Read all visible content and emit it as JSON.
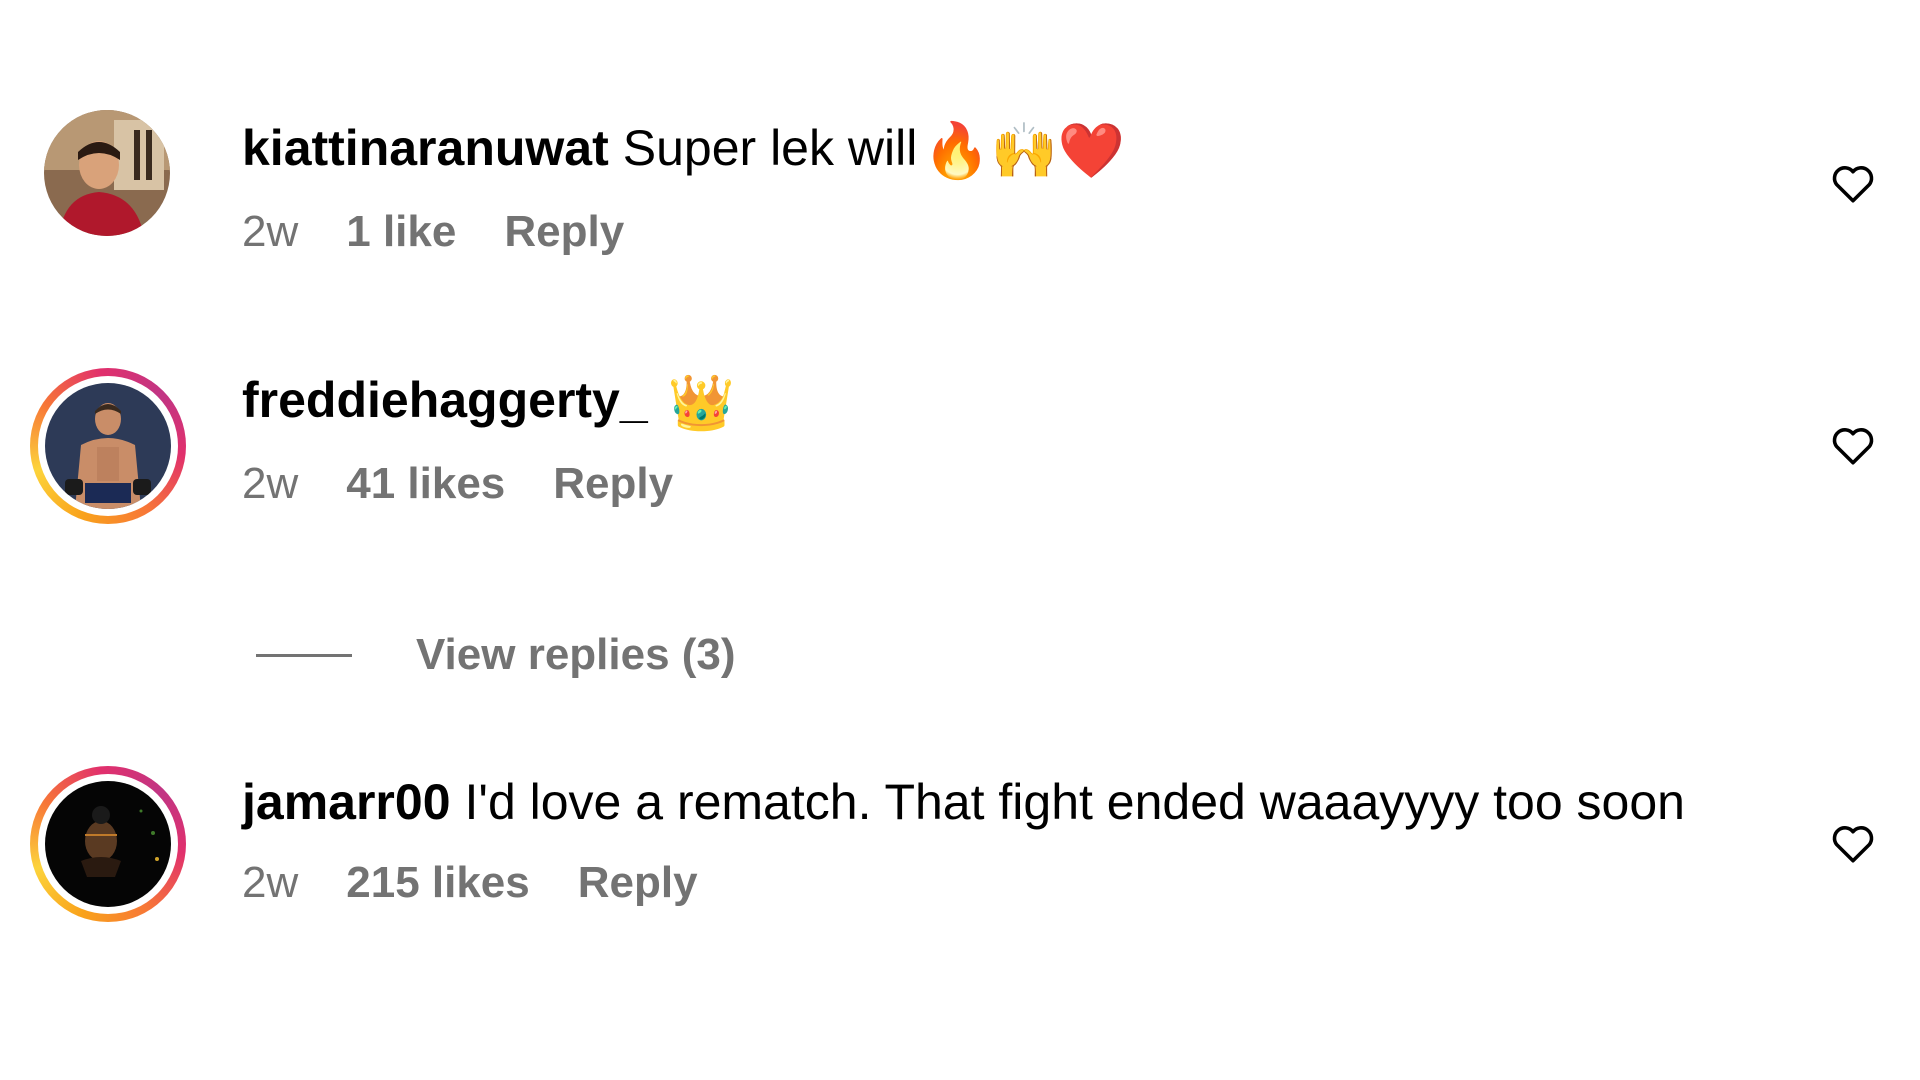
{
  "comments": [
    {
      "username": "kiattinaranuwat",
      "text": "Super lek will",
      "emojis": "🔥🙌❤️",
      "time": "2w",
      "likes": "1 like",
      "reply": "Reply",
      "has_story": false,
      "avatar_icon": "profile-photo"
    },
    {
      "username": "freddiehaggerty_",
      "text": "",
      "emojis": "👑",
      "time": "2w",
      "likes": "41 likes",
      "reply": "Reply",
      "has_story": true,
      "avatar_icon": "profile-photo"
    },
    {
      "username": "jamarr00",
      "text": "I'd love a rematch. That fight ended waaayyyy too soon",
      "emojis": "",
      "time": "2w",
      "likes": "215 likes",
      "reply": "Reply",
      "has_story": true,
      "avatar_icon": "profile-photo"
    }
  ],
  "view_replies": "View replies (3)",
  "icons": {
    "like": "heart-outline-icon"
  },
  "colors": {
    "meta_text": "#737373",
    "story_ring_start": "#f9a21b",
    "story_ring_end": "#c13584"
  }
}
